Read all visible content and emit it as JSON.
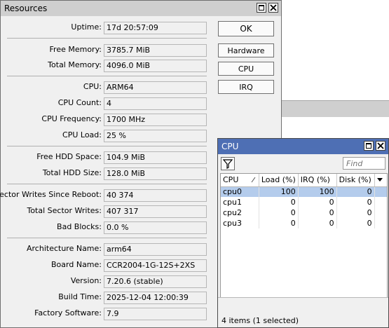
{
  "resources_window": {
    "title": "Resources",
    "fields": {
      "uptime": {
        "label": "Uptime:",
        "value": "17d 20:57:09"
      },
      "free_memory": {
        "label": "Free Memory:",
        "value": "3785.7 MiB"
      },
      "total_memory": {
        "label": "Total Memory:",
        "value": "4096.0 MiB"
      },
      "cpu": {
        "label": "CPU:",
        "value": "ARM64"
      },
      "cpu_count": {
        "label": "CPU Count:",
        "value": "4"
      },
      "cpu_frequency": {
        "label": "CPU Frequency:",
        "value": "1700 MHz"
      },
      "cpu_load": {
        "label": "CPU Load:",
        "value": "25 %"
      },
      "free_hdd": {
        "label": "Free HDD Space:",
        "value": "104.9 MiB"
      },
      "total_hdd": {
        "label": "Total HDD Size:",
        "value": "128.0 MiB"
      },
      "sector_writes_reboot": {
        "label": "Sector Writes Since Reboot:",
        "value": "40 374"
      },
      "total_sector_writes": {
        "label": "Total Sector Writes:",
        "value": "407 317"
      },
      "bad_blocks": {
        "label": "Bad Blocks:",
        "value": "0.0 %"
      },
      "architecture": {
        "label": "Architecture Name:",
        "value": "arm64"
      },
      "board_name": {
        "label": "Board Name:",
        "value": "CCR2004-1G-12S+2XS"
      },
      "version": {
        "label": "Version:",
        "value": "7.20.6 (stable)"
      },
      "build_time": {
        "label": "Build Time:",
        "value": "2025-12-04 12:00:39"
      },
      "factory_software": {
        "label": "Factory Software:",
        "value": "7.9"
      }
    },
    "buttons": {
      "ok": "OK",
      "hardware": "Hardware",
      "cpu": "CPU",
      "irq": "IRQ"
    }
  },
  "cpu_window": {
    "title": "CPU",
    "find_placeholder": "Find",
    "columns": [
      "CPU",
      "Load (%)",
      "IRQ (%)",
      "Disk (%)"
    ],
    "rows": [
      {
        "cpu": "cpu0",
        "load": "100",
        "irq": "100",
        "disk": "0",
        "selected": true
      },
      {
        "cpu": "cpu1",
        "load": "0",
        "irq": "0",
        "disk": "0",
        "selected": false
      },
      {
        "cpu": "cpu2",
        "load": "0",
        "irq": "0",
        "disk": "0",
        "selected": false
      },
      {
        "cpu": "cpu3",
        "load": "0",
        "irq": "0",
        "disk": "0",
        "selected": false
      }
    ],
    "status": "4 items (1 selected)"
  },
  "colors": {
    "resources_title_bg": "#cfcfcf",
    "cpu_title_bg": "#4e6fb4",
    "selection": "#b4ccec",
    "window_bg": "#f0f0f0"
  },
  "icons": [
    "maximize-icon",
    "close-icon",
    "filter-icon",
    "dropdown-arrow-icon",
    "sort-arrow-icon"
  ]
}
